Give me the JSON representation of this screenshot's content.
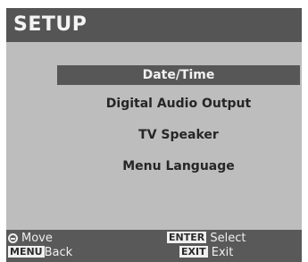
{
  "header": {
    "title": "SETUP"
  },
  "menu": {
    "items": [
      {
        "label": "Date/Time",
        "selected": true
      },
      {
        "label": "Digital Audio Output",
        "selected": false
      },
      {
        "label": "TV Speaker",
        "selected": false
      },
      {
        "label": "Menu Language",
        "selected": false
      }
    ]
  },
  "footer": {
    "move_label": "Move",
    "menu_key": "MENU",
    "back_label": "Back",
    "enter_key": "ENTER",
    "select_label": "Select",
    "exit_key": "EXIT",
    "exit_label": "Exit"
  },
  "colors": {
    "background": "#bdbdbd",
    "title_bar": "#555555",
    "selection": "#575757",
    "footer": "#595959"
  }
}
